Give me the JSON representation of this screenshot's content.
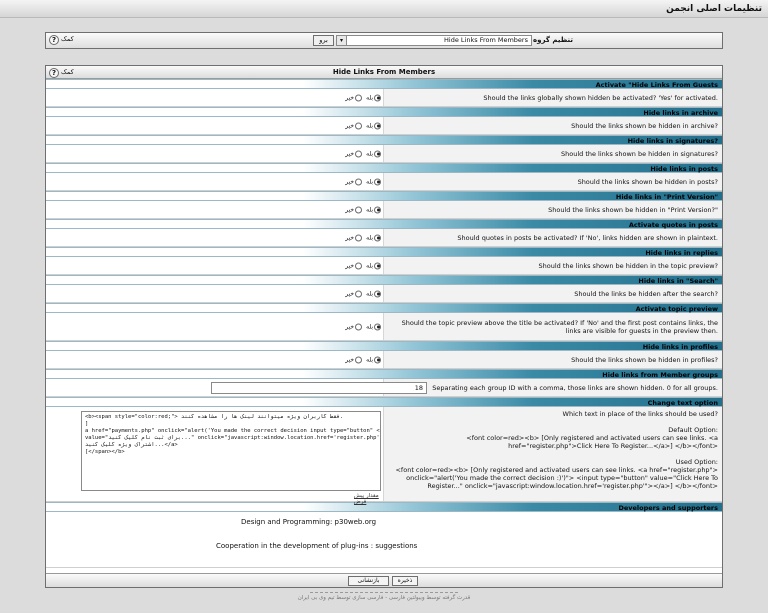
{
  "window": {
    "title": "تنظیمات اصلی انجمن"
  },
  "group_bar": {
    "label": "تنظیم گروه",
    "selected": "Hide Links From Members",
    "go_label": "برو",
    "help_label": "کمک",
    "help_icon": "?"
  },
  "panel": {
    "title": "Hide Links From Members",
    "help_label": "کمک",
    "help_icon": "?"
  },
  "radio_labels": {
    "yes": "بله",
    "no": "خیر"
  },
  "sections": [
    {
      "title": "Activate \"Hide Links From Guests",
      "desc": "Should the links globally shown hidden be activated? 'Yes' for activated."
    },
    {
      "title": "Hide links in archive",
      "desc": "Should the links shown be hidden in archive?"
    },
    {
      "title": "Hide links in signatures?",
      "desc": "Should the links shown be hidden in signatures?"
    },
    {
      "title": "Hide links in posts",
      "desc": "Should the links shown be hidden in posts?"
    },
    {
      "title": "Hide links in \"Print Version\"",
      "desc": "Should the links shown be hidden in \"Print Version?\""
    },
    {
      "title": "Activate quotes in posts",
      "desc": "Should quotes in posts be activated? If 'No', links hidden are shown in plaintext."
    },
    {
      "title": "Hide links in replies",
      "desc": "Should the links shown be hidden in the topic preview?"
    },
    {
      "title": "Hide links in \"Search\"",
      "desc": "Should the links be hidden after the search?"
    },
    {
      "title": "Activate topic preview",
      "desc": "Should the topic preview above the title be activated? If 'No' and the first post contains links, the links are visible for guests in the preview then.",
      "desc_lines": [
        "Should the topic preview above the title be activated? If 'No' and the first post contains links, the",
        "links are visible for guests in the preview then."
      ]
    },
    {
      "title": "Hide links in profiles",
      "desc": "Should the links shown be hidden in profiles?"
    }
  ],
  "member_groups": {
    "title": "Hide links from Member groups",
    "desc": "Separating each group ID with a comma, those links are shown hidden. 0 for all groups.",
    "value": "18"
  },
  "change_text": {
    "title": "Change text option",
    "desc_lines": [
      "Which text in place of the links should be used?",
      "",
      "Default Option:",
      "<font color=red><b> [Only registered and activated users can see links. <a",
      "href=\"register.php\">Click Here To Register...</a>] </b></font>",
      "",
      "Used Option:",
      "<font color=red><b> [Only registered and activated users can see links. <a href=\"register.php\">",
      "onclick=\"alert('You made the correct decision :)')\"> <input type=\"button\" value=\"Click Here To",
      "Register...\" onclick=\"javascript:window.location.href='register.php'\"></a>] </b></font>"
    ],
    "textarea_lines": [
      "<b><span style=\"color:red;\"> فقط کاربران ویژه میتوانند لینک ها را مشاهده کنند.",
      "]",
      "a href=\"payments.php\" onclick=\"alert('You made the correct decision input type=\"button\" <",
      "value=\"برای ثبت نام کلیک کنید...\" onclick=\"javascript:window.location.href='register.php'\"><برای تهیه",
      "اشتراک ویژه کلیک کنید...</a>",
      "[</span></b>"
    ],
    "default_link": "مقدار پیش فرض"
  },
  "developers": {
    "title": "Developers and supporters",
    "design_line": "Design and Programming: p30web.org",
    "coop_line": "Cooperation in the development of plug-ins : suggestions"
  },
  "buttons": {
    "save": "ذخیره",
    "reset": "بازنشانی"
  },
  "footer": {
    "text": "قدرت گرفته توسط ویبولتین فارسی - فارسی سازی توسط تیم وی بی ایران"
  }
}
